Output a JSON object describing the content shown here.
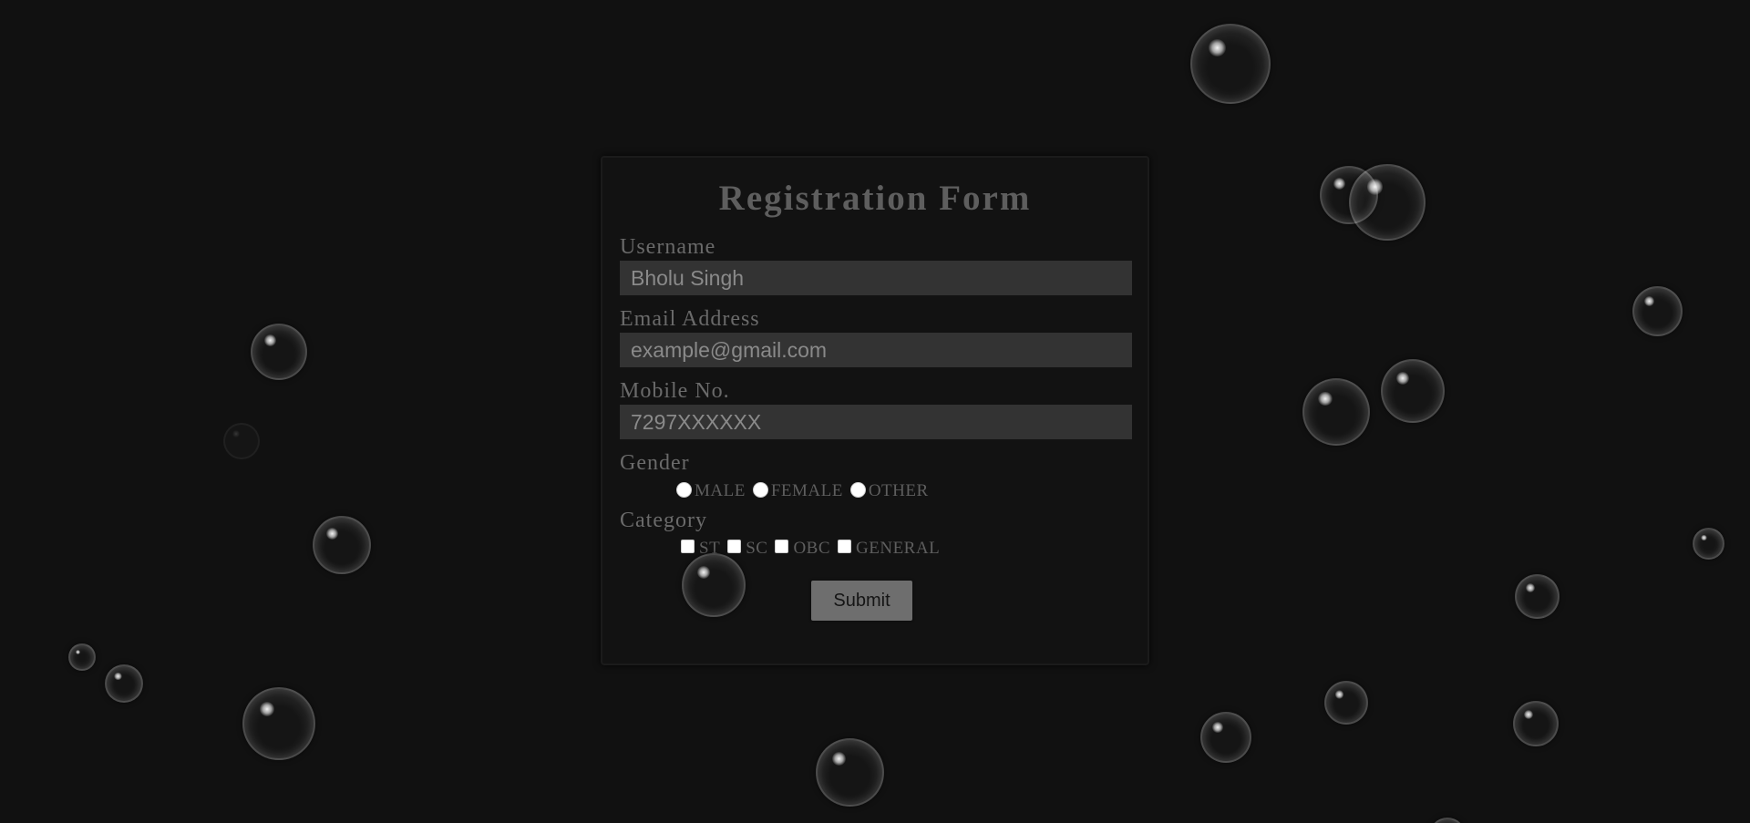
{
  "form": {
    "title": "Registration Form",
    "username_label": "Username",
    "username_value": "Bholu Singh",
    "email_label": "Email Address",
    "email_placeholder": "example@gmail.com",
    "mobile_label": "Mobile No.",
    "mobile_placeholder": "7297XXXXXX",
    "gender_label": "Gender",
    "gender_options": [
      "MALE",
      "FEMALE",
      "OTHER"
    ],
    "category_label": "Category",
    "category_options": [
      "ST",
      "SC",
      "OBC",
      "GENERAL"
    ],
    "submit_label": "Submit"
  },
  "colors": {
    "background": "#111111",
    "card_background": "#121212",
    "input_background": "#333333",
    "text": "#6a6a6a",
    "button": "#6e6e6e"
  },
  "icons": {
    "bubble": "bubble-icon",
    "radio": "radio-circle",
    "checkbox": "checkbox-square"
  }
}
